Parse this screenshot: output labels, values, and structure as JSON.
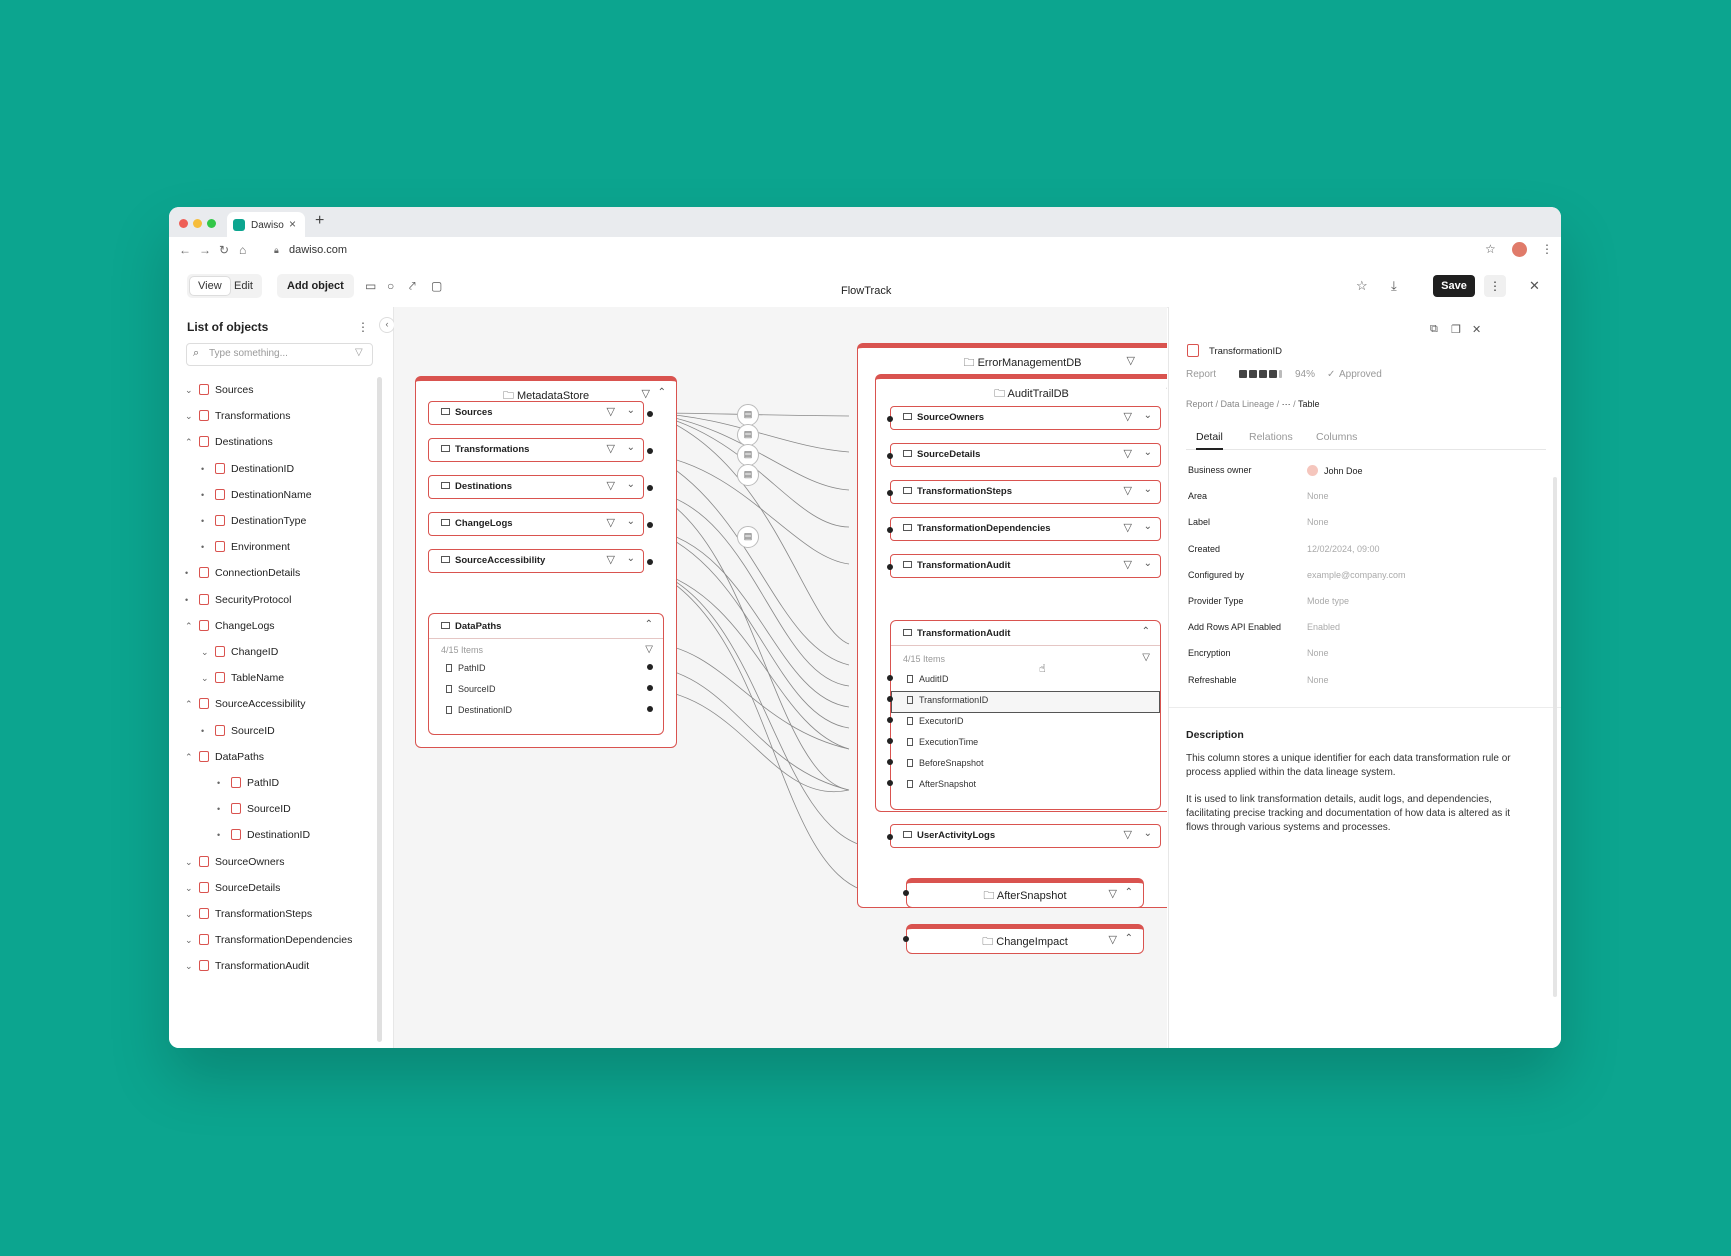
{
  "browser": {
    "tab_title": "Dawiso",
    "url": "dawiso.com",
    "tab_close": "×",
    "new_tab": "+"
  },
  "toolbar": {
    "view_label": "View",
    "edit_label": "Edit",
    "add_object_label": "Add object",
    "app_title": "FlowTrack",
    "save_label": "Save"
  },
  "left_panel": {
    "title": "List of objects",
    "search_placeholder": "Type something...",
    "items": [
      {
        "label": "Sources",
        "chevron": "⌄",
        "indent": 0
      },
      {
        "label": "Transformations",
        "chevron": "⌄",
        "indent": 0
      },
      {
        "label": "Destinations",
        "chevron": "⌃",
        "indent": 0
      },
      {
        "label": "DestinationID",
        "chevron": "•",
        "indent": 1
      },
      {
        "label": "DestinationName",
        "chevron": "•",
        "indent": 1
      },
      {
        "label": "DestinationType",
        "chevron": "•",
        "indent": 1
      },
      {
        "label": "Environment",
        "chevron": "•",
        "indent": 1
      },
      {
        "label": "ConnectionDetails",
        "chevron": "•",
        "indent": 0
      },
      {
        "label": "SecurityProtocol",
        "chevron": "•",
        "indent": 0
      },
      {
        "label": "ChangeLogs",
        "chevron": "⌃",
        "indent": 0
      },
      {
        "label": "ChangeID",
        "chevron": "⌄",
        "indent": 1
      },
      {
        "label": "TableName",
        "chevron": "⌄",
        "indent": 1
      },
      {
        "label": "SourceAccessibility",
        "chevron": "⌃",
        "indent": 0
      },
      {
        "label": "SourceID",
        "chevron": "•",
        "indent": 1
      },
      {
        "label": "DataPaths",
        "chevron": "⌃",
        "indent": 0
      },
      {
        "label": "PathID",
        "chevron": "•",
        "indent": 2
      },
      {
        "label": "SourceID",
        "chevron": "•",
        "indent": 2
      },
      {
        "label": "DestinationID",
        "chevron": "•",
        "indent": 2
      },
      {
        "label": "SourceOwners",
        "chevron": "⌄",
        "indent": 0
      },
      {
        "label": "SourceDetails",
        "chevron": "⌄",
        "indent": 0
      },
      {
        "label": "TransformationSteps",
        "chevron": "⌄",
        "indent": 0
      },
      {
        "label": "TransformationDependencies",
        "chevron": "⌄",
        "indent": 0
      },
      {
        "label": "TransformationAudit",
        "chevron": "⌄",
        "indent": 0
      }
    ]
  },
  "canvas": {
    "metadata_store": {
      "title": "MetadataStore",
      "rows": [
        "Sources",
        "Transformations",
        "Destinations",
        "ChangeLogs",
        "SourceAccessibility"
      ],
      "datapaths": {
        "title": "DataPaths",
        "count": "4/15 Items",
        "columns": [
          "PathID",
          "SourceID",
          "DestinationID"
        ]
      }
    },
    "error_db": {
      "title": "ErrorManagementDB",
      "audit_db": {
        "title": "AuditTrailDB",
        "rows": [
          "SourceOwners",
          "SourceDetails",
          "TransformationSteps",
          "TransformationDependencies",
          "TransformationAudit"
        ],
        "expanded": {
          "title": "TransformationAudit",
          "count": "4/15 Items",
          "columns": [
            "AuditID",
            "TransformationID",
            "ExecutorID",
            "ExecutionTime",
            "BeforeSnapshot",
            "AfterSnapshot"
          ]
        },
        "last_row": "UserActivityLogs"
      }
    },
    "after_snapshot": "AfterSnapshot",
    "change_impact": "ChangeImpact"
  },
  "right_panel": {
    "object_name": "TransformationID",
    "type": "Report",
    "progress_percent": 94,
    "progress_label": "94%",
    "status": "Approved",
    "breadcrumb": [
      "Report",
      "Data Lineage",
      "···",
      "Table"
    ],
    "tabs": [
      "Detail",
      "Relations",
      "Columns"
    ],
    "properties": [
      {
        "key": "Business owner",
        "value": "John Doe"
      },
      {
        "key": "Area",
        "value": "None"
      },
      {
        "key": "Label",
        "value": "None"
      },
      {
        "key": "Created",
        "value": "12/02/2024, 09:00"
      },
      {
        "key": "Configured by",
        "value": "example@company.com"
      },
      {
        "key": "Provider Type",
        "value": "Mode type"
      },
      {
        "key": "Add Rows API Enabled",
        "value": "Enabled"
      },
      {
        "key": "Encryption",
        "value": "None"
      },
      {
        "key": "Refreshable",
        "value": "None"
      }
    ],
    "description_title": "Description",
    "description_p1": "This column stores a unique identifier for each data transformation rule or process applied within the data lineage system.",
    "description_p2": "It is used to link transformation details, audit logs, and dependencies, facilitating precise tracking and documentation of how data is altered as it flows through various systems and processes."
  },
  "colors": {
    "background": "#0ca58f",
    "accent": "#d9534f",
    "save": "#1f1f1f"
  }
}
